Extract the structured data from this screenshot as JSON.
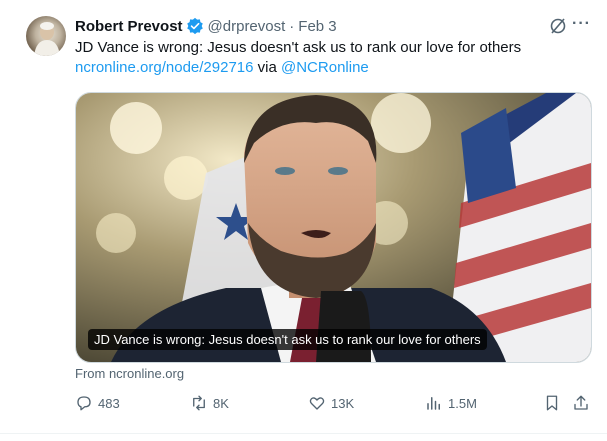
{
  "author": {
    "name": "Robert Prevost",
    "handle": "@drprevost",
    "separator": "·",
    "date": "Feb 3"
  },
  "tweet": {
    "text": "JD Vance is wrong: Jesus doesn't ask us to rank our love for others",
    "link_url": "ncronline.org/node/292716",
    "via_word": " via ",
    "via_handle": "@NCRonline"
  },
  "card": {
    "caption": "JD Vance is wrong: Jesus doesn't ask us to rank our love for others",
    "source": "From ncronline.org"
  },
  "actions": {
    "replies": "483",
    "reposts": "8K",
    "likes": "13K",
    "views": "1.5M"
  },
  "icons": [
    "verified-icon",
    "grok-icon",
    "more-icon",
    "reply-icon",
    "repost-icon",
    "like-icon",
    "views-icon",
    "bookmark-icon",
    "share-icon"
  ],
  "colors": {
    "link": "#1d9bf0",
    "secondary": "#536471",
    "verified": "#1d9bf0"
  }
}
